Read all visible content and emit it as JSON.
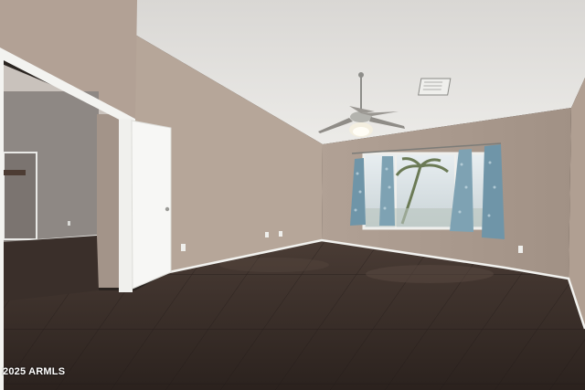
{
  "scene": {
    "description_tag": "empty-room-interior",
    "colors": {
      "ceiling": "#e6e4e1",
      "wall_left_near": "#b3a397",
      "wall_middle": "#b8a89c",
      "wall_back": "#a9998d",
      "hall_wall": "#8f8985",
      "floor": "#3c302a",
      "trim": "#f2f2ef",
      "curtain": "#6f95a8",
      "window_light": "#d9e2e6"
    }
  },
  "watermark": {
    "text": "2025 ARMLS"
  }
}
